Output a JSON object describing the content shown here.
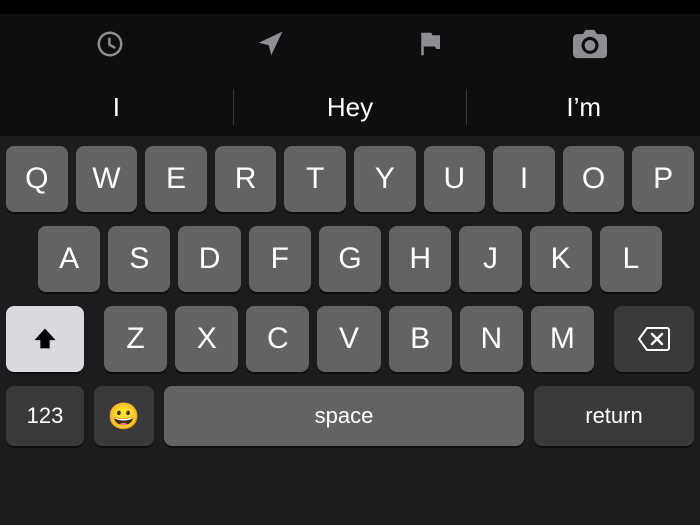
{
  "toolbar": {
    "icons": [
      "clock-icon",
      "location-icon",
      "flag-icon",
      "camera-icon"
    ]
  },
  "suggestions": [
    "I",
    "Hey",
    "I’m"
  ],
  "keyboard": {
    "row1": [
      "Q",
      "W",
      "E",
      "R",
      "T",
      "Y",
      "U",
      "I",
      "O",
      "P"
    ],
    "row2": [
      "A",
      "S",
      "D",
      "F",
      "G",
      "H",
      "J",
      "K",
      "L"
    ],
    "row3": [
      "Z",
      "X",
      "C",
      "V",
      "B",
      "N",
      "M"
    ],
    "numKey": "123",
    "emoji": "😀",
    "space": "space",
    "return": "return"
  }
}
